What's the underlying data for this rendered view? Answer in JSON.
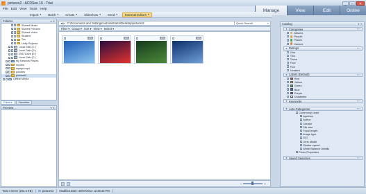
{
  "window": {
    "title": "pictures2 - ACDSee 16 - Trial",
    "controls": [
      "_",
      "□",
      "✕"
    ]
  },
  "menu": [
    "File",
    "Edit",
    "View",
    "Tools",
    "Help"
  ],
  "mode_tabs": [
    "Manage",
    "View",
    "Edit",
    "Online"
  ],
  "toolbar": [
    "Import",
    "Batch",
    "Create",
    "Slideshow",
    "Send",
    "External Editors"
  ],
  "folders_panel": {
    "title": "Folders",
    "tree": [
      {
        "label": "Shared Music",
        "indent": 3,
        "type": "folder"
      },
      {
        "label": "Shared Pictures",
        "indent": 3,
        "type": "folder"
      },
      {
        "label": "Shared Video",
        "indent": 3,
        "type": "folder"
      },
      {
        "label": "Student",
        "indent": 3,
        "type": "folder"
      },
      {
        "label": "Tco",
        "indent": 3,
        "type": "folder"
      },
      {
        "label": "Unity Projects",
        "indent": 3,
        "type": "folder"
      },
      {
        "label": "Local Disk (C:)",
        "indent": 2,
        "type": "drive"
      },
      {
        "label": "Local Disk (D:)",
        "indent": 2,
        "type": "drive"
      },
      {
        "label": "DVD Drive (E:)",
        "indent": 2,
        "type": "drive"
      },
      {
        "label": "Local Disk (F:)",
        "indent": 2,
        "type": "drive"
      },
      {
        "label": "My Network Places",
        "indent": 1,
        "type": "net"
      },
      {
        "label": "movies",
        "indent": 1,
        "type": "folder"
      },
      {
        "label": "mpegd.mp4",
        "indent": 1,
        "type": "folder"
      },
      {
        "label": "pictures",
        "indent": 1,
        "type": "folder"
      },
      {
        "label": "pictures2",
        "indent": 1,
        "type": "folder",
        "selected": true
      },
      {
        "label": "Offline Media",
        "indent": 0,
        "type": "pc"
      }
    ],
    "tabs": [
      "Folders",
      "Favorites"
    ]
  },
  "preview_panel": {
    "title": "Preview"
  },
  "address": {
    "path": "C:\\Documents and Settings\\Administrator\\Desktop\\pictures2",
    "quick_search": "Quick Search"
  },
  "filter_bar": [
    "Filter",
    "Group",
    "Sort",
    "View",
    "Select"
  ],
  "thumbnails": [
    {
      "ext": "JPG",
      "colors": [
        "#1f5fb8",
        "#8fc4ee"
      ]
    },
    {
      "ext": "JPG",
      "colors": [
        "#2a0d3f",
        "#e3342e"
      ]
    },
    {
      "ext": "JPG",
      "colors": [
        "#153a1c",
        "#4d8a3a"
      ]
    },
    {
      "ext": "JPG",
      "colors": [
        "#0d2f6b",
        "#6f9fd8"
      ]
    }
  ],
  "status": {
    "total": "Total 4 items (202.3 KB)",
    "folder": "pictures2",
    "modified": "Modified Date: 30/07/2013 12:49:43 PM"
  },
  "catalog": {
    "title": "Catalog",
    "categories": {
      "title": "Categories",
      "items": [
        {
          "label": "Albums",
          "color": "#d1b45a"
        },
        {
          "label": "People",
          "color": "#e0a64c"
        },
        {
          "label": "Places",
          "color": "#4fa862"
        },
        {
          "label": "Various",
          "color": "#d98b3a"
        }
      ]
    },
    "ratings": {
      "title": "Ratings",
      "items": [
        "One",
        "Two",
        "Three",
        "Four",
        "Five",
        "Unrated"
      ]
    },
    "labels": {
      "title": "Labels (Default)",
      "items": [
        {
          "label": "Red",
          "color": "#d93a2e"
        },
        {
          "label": "Yellow",
          "color": "#e8d23a"
        },
        {
          "label": "Green",
          "color": "#3aa24a"
        },
        {
          "label": "Blue",
          "color": "#2f6fd1"
        },
        {
          "label": "Purple",
          "color": "#8b3ab8"
        },
        {
          "label": "Unlabeled",
          "color": "#ffffff"
        }
      ]
    },
    "keywords": {
      "title": "Keywords"
    },
    "auto_categories": {
      "title": "Auto Categories",
      "items": [
        {
          "label": "Commonly Used",
          "level": 0
        },
        {
          "label": "Aperture",
          "level": 1
        },
        {
          "label": "Author",
          "level": 1
        },
        {
          "label": "Creator",
          "level": 1
        },
        {
          "label": "File size",
          "level": 1
        },
        {
          "label": "Focal length",
          "level": 1
        },
        {
          "label": "Image type",
          "level": 1
        },
        {
          "label": "ISO",
          "level": 1
        },
        {
          "label": "Lens Model",
          "level": 1
        },
        {
          "label": "Shutter speed",
          "level": 1
        },
        {
          "label": "White Balance Details",
          "level": 1
        },
        {
          "label": "Photo Properties",
          "level": 0
        }
      ]
    },
    "saved_searches": {
      "title": "Saved Searches"
    }
  }
}
